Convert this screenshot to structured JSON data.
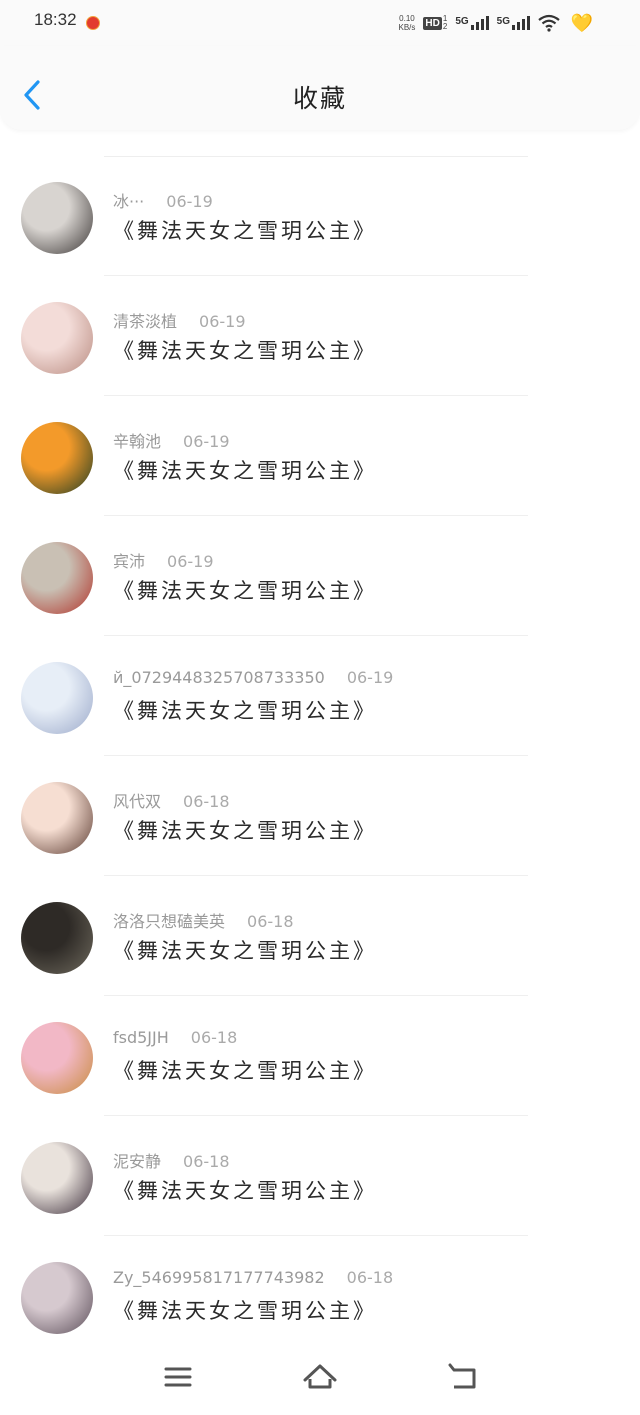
{
  "status_bar": {
    "time": "18:32",
    "net_speed_value": "0.10",
    "net_speed_unit": "KB/s",
    "hd_label": "HD",
    "hd_sim_top": "1",
    "hd_sim_bottom": "2",
    "signal1_label": "5G",
    "signal2_label": "5G",
    "icons": [
      "notification-icon",
      "hd-icon",
      "signal-icon",
      "signal-icon",
      "wifi-icon",
      "heart-icon"
    ]
  },
  "header": {
    "title": "收藏",
    "back_icon": "chevron-left-icon",
    "accent_color": "#2196f3"
  },
  "items": [
    {
      "user": "冰···",
      "date": "06-19",
      "title": "《舞法天女之雪玥公主》"
    },
    {
      "user": "清茶淡植",
      "date": "06-19",
      "title": "《舞法天女之雪玥公主》"
    },
    {
      "user": "辛翰池",
      "date": "06-19",
      "title": "《舞法天女之雪玥公主》"
    },
    {
      "user": "宾沛",
      "date": "06-19",
      "title": "《舞法天女之雪玥公主》"
    },
    {
      "user": "й_0729448325708733350",
      "date": "06-19",
      "title": "《舞法天女之雪玥公主》"
    },
    {
      "user": "风代双",
      "date": "06-18",
      "title": "《舞法天女之雪玥公主》"
    },
    {
      "user": "洛洛只想磕美英",
      "date": "06-18",
      "title": "《舞法天女之雪玥公主》"
    },
    {
      "user": "fsd5JJH",
      "date": "06-18",
      "title": "《舞法天女之雪玥公主》"
    },
    {
      "user": "泥安静",
      "date": "06-18",
      "title": "《舞法天女之雪玥公主》"
    },
    {
      "user": "Zy_546995817177743982",
      "date": "06-18",
      "title": "《舞法天女之雪玥公主》"
    }
  ],
  "avatar_colors": [
    [
      "#d8d4d0",
      "#3a3534"
    ],
    [
      "#f3dcd8",
      "#b88a7f"
    ],
    [
      "#f39a2a",
      "#1d3b22"
    ],
    [
      "#c9c0b4",
      "#b03228"
    ],
    [
      "#e7eef7",
      "#9aa8c9"
    ],
    [
      "#f6ded2",
      "#5a3a30"
    ],
    [
      "#2e2a26",
      "#6f6a5e"
    ],
    [
      "#f2b8c6",
      "#c78a3c"
    ],
    [
      "#e9e2dc",
      "#3b2d3a"
    ],
    [
      "#d6c9cf",
      "#5a4c57"
    ]
  ],
  "nav_bar": {
    "icons": [
      "menu-icon",
      "home-icon",
      "back-icon"
    ]
  }
}
